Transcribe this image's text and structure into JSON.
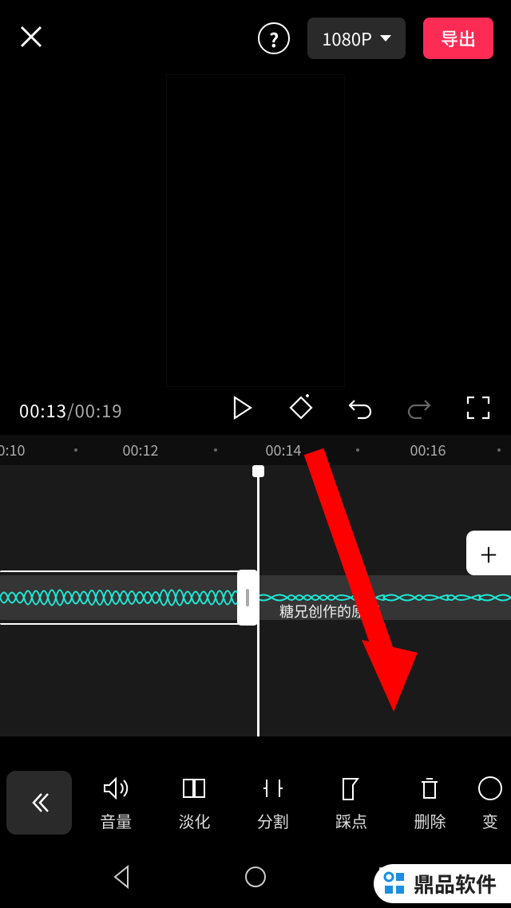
{
  "header": {
    "resolution_label": "1080P",
    "export_label": "导出"
  },
  "transport": {
    "current_time": "00:13",
    "total_time": "00:19"
  },
  "ruler": {
    "ticks": [
      "0:10",
      "00:12",
      "00:14",
      "00:16"
    ]
  },
  "timeline": {
    "clip_label": "糖兄创作的原声",
    "add_label": "+"
  },
  "tools": {
    "volume": "音量",
    "fade": "淡化",
    "split": "分割",
    "beat": "踩点",
    "delete": "删除",
    "change": "变"
  },
  "watermark": {
    "text": "鼎品软件"
  }
}
